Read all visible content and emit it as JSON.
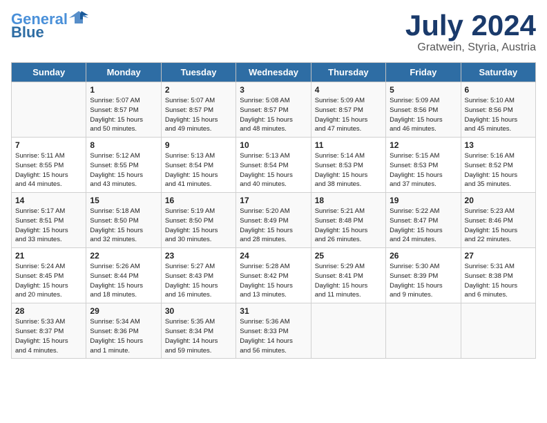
{
  "header": {
    "logo_line1": "General",
    "logo_line2": "Blue",
    "month": "July 2024",
    "location": "Gratwein, Styria, Austria"
  },
  "weekdays": [
    "Sunday",
    "Monday",
    "Tuesday",
    "Wednesday",
    "Thursday",
    "Friday",
    "Saturday"
  ],
  "weeks": [
    [
      {
        "day": "",
        "info": ""
      },
      {
        "day": "1",
        "info": "Sunrise: 5:07 AM\nSunset: 8:57 PM\nDaylight: 15 hours\nand 50 minutes."
      },
      {
        "day": "2",
        "info": "Sunrise: 5:07 AM\nSunset: 8:57 PM\nDaylight: 15 hours\nand 49 minutes."
      },
      {
        "day": "3",
        "info": "Sunrise: 5:08 AM\nSunset: 8:57 PM\nDaylight: 15 hours\nand 48 minutes."
      },
      {
        "day": "4",
        "info": "Sunrise: 5:09 AM\nSunset: 8:57 PM\nDaylight: 15 hours\nand 47 minutes."
      },
      {
        "day": "5",
        "info": "Sunrise: 5:09 AM\nSunset: 8:56 PM\nDaylight: 15 hours\nand 46 minutes."
      },
      {
        "day": "6",
        "info": "Sunrise: 5:10 AM\nSunset: 8:56 PM\nDaylight: 15 hours\nand 45 minutes."
      }
    ],
    [
      {
        "day": "7",
        "info": "Sunrise: 5:11 AM\nSunset: 8:55 PM\nDaylight: 15 hours\nand 44 minutes."
      },
      {
        "day": "8",
        "info": "Sunrise: 5:12 AM\nSunset: 8:55 PM\nDaylight: 15 hours\nand 43 minutes."
      },
      {
        "day": "9",
        "info": "Sunrise: 5:13 AM\nSunset: 8:54 PM\nDaylight: 15 hours\nand 41 minutes."
      },
      {
        "day": "10",
        "info": "Sunrise: 5:13 AM\nSunset: 8:54 PM\nDaylight: 15 hours\nand 40 minutes."
      },
      {
        "day": "11",
        "info": "Sunrise: 5:14 AM\nSunset: 8:53 PM\nDaylight: 15 hours\nand 38 minutes."
      },
      {
        "day": "12",
        "info": "Sunrise: 5:15 AM\nSunset: 8:53 PM\nDaylight: 15 hours\nand 37 minutes."
      },
      {
        "day": "13",
        "info": "Sunrise: 5:16 AM\nSunset: 8:52 PM\nDaylight: 15 hours\nand 35 minutes."
      }
    ],
    [
      {
        "day": "14",
        "info": "Sunrise: 5:17 AM\nSunset: 8:51 PM\nDaylight: 15 hours\nand 33 minutes."
      },
      {
        "day": "15",
        "info": "Sunrise: 5:18 AM\nSunset: 8:50 PM\nDaylight: 15 hours\nand 32 minutes."
      },
      {
        "day": "16",
        "info": "Sunrise: 5:19 AM\nSunset: 8:50 PM\nDaylight: 15 hours\nand 30 minutes."
      },
      {
        "day": "17",
        "info": "Sunrise: 5:20 AM\nSunset: 8:49 PM\nDaylight: 15 hours\nand 28 minutes."
      },
      {
        "day": "18",
        "info": "Sunrise: 5:21 AM\nSunset: 8:48 PM\nDaylight: 15 hours\nand 26 minutes."
      },
      {
        "day": "19",
        "info": "Sunrise: 5:22 AM\nSunset: 8:47 PM\nDaylight: 15 hours\nand 24 minutes."
      },
      {
        "day": "20",
        "info": "Sunrise: 5:23 AM\nSunset: 8:46 PM\nDaylight: 15 hours\nand 22 minutes."
      }
    ],
    [
      {
        "day": "21",
        "info": "Sunrise: 5:24 AM\nSunset: 8:45 PM\nDaylight: 15 hours\nand 20 minutes."
      },
      {
        "day": "22",
        "info": "Sunrise: 5:26 AM\nSunset: 8:44 PM\nDaylight: 15 hours\nand 18 minutes."
      },
      {
        "day": "23",
        "info": "Sunrise: 5:27 AM\nSunset: 8:43 PM\nDaylight: 15 hours\nand 16 minutes."
      },
      {
        "day": "24",
        "info": "Sunrise: 5:28 AM\nSunset: 8:42 PM\nDaylight: 15 hours\nand 13 minutes."
      },
      {
        "day": "25",
        "info": "Sunrise: 5:29 AM\nSunset: 8:41 PM\nDaylight: 15 hours\nand 11 minutes."
      },
      {
        "day": "26",
        "info": "Sunrise: 5:30 AM\nSunset: 8:39 PM\nDaylight: 15 hours\nand 9 minutes."
      },
      {
        "day": "27",
        "info": "Sunrise: 5:31 AM\nSunset: 8:38 PM\nDaylight: 15 hours\nand 6 minutes."
      }
    ],
    [
      {
        "day": "28",
        "info": "Sunrise: 5:33 AM\nSunset: 8:37 PM\nDaylight: 15 hours\nand 4 minutes."
      },
      {
        "day": "29",
        "info": "Sunrise: 5:34 AM\nSunset: 8:36 PM\nDaylight: 15 hours\nand 1 minute."
      },
      {
        "day": "30",
        "info": "Sunrise: 5:35 AM\nSunset: 8:34 PM\nDaylight: 14 hours\nand 59 minutes."
      },
      {
        "day": "31",
        "info": "Sunrise: 5:36 AM\nSunset: 8:33 PM\nDaylight: 14 hours\nand 56 minutes."
      },
      {
        "day": "",
        "info": ""
      },
      {
        "day": "",
        "info": ""
      },
      {
        "day": "",
        "info": ""
      }
    ]
  ]
}
